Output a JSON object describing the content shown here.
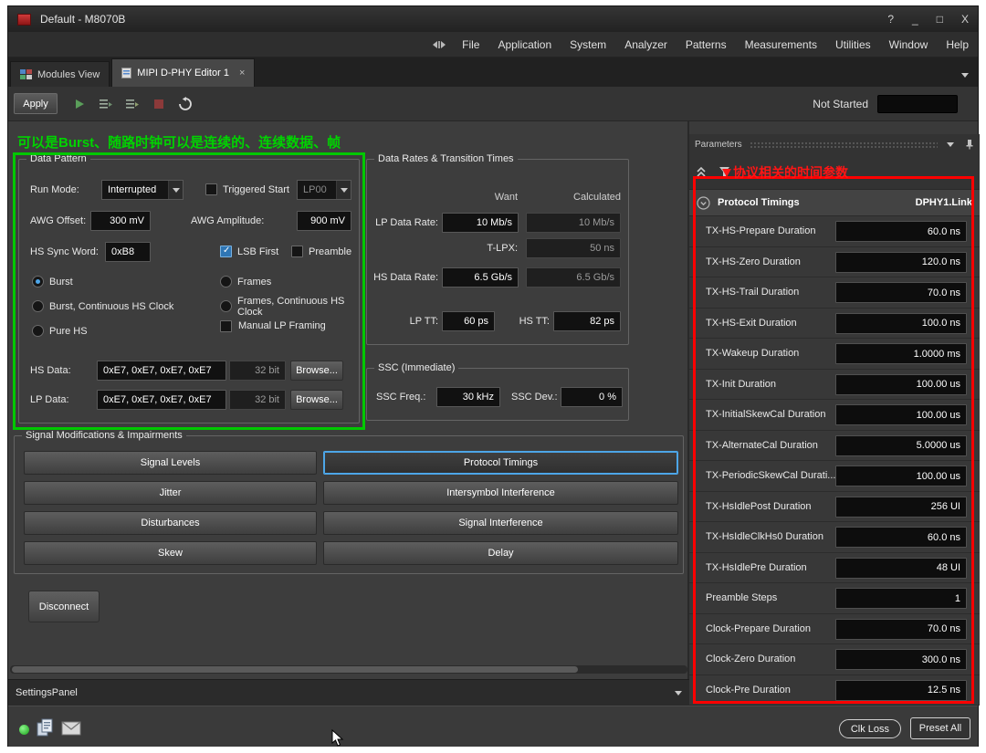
{
  "window": {
    "title": "Default - M8070B",
    "controls": {
      "help": "?",
      "minimize": "_",
      "maximize": "□",
      "close": "X"
    }
  },
  "menu": {
    "items": [
      "File",
      "Application",
      "System",
      "Analyzer",
      "Patterns",
      "Measurements",
      "Utilities",
      "Window",
      "Help"
    ]
  },
  "tabs": {
    "modules": "Modules View",
    "editor": "MIPI D-PHY Editor 1",
    "close": "×"
  },
  "toolbar": {
    "apply": "Apply",
    "status": "Not Started",
    "elapsed": ""
  },
  "annotations": {
    "green": "可以是Burst、随路时钟可以是连续的、连续数据、帧",
    "red": "协议相关的时间参数"
  },
  "colors": {
    "annotation_green": "#00c800",
    "annotation_red": "#ff0000",
    "selection_blue": "#4da6e8"
  },
  "data_pattern": {
    "title": "Data Pattern",
    "run_mode": {
      "label": "Run Mode:",
      "value": "Interrupted"
    },
    "triggered_start": "Triggered Start",
    "lp_state": "LP00",
    "awg_offset": {
      "label": "AWG Offset:",
      "value": "300 mV"
    },
    "awg_amplitude": {
      "label": "AWG Amplitude:",
      "value": "900 mV"
    },
    "hs_sync_word": {
      "label": "HS Sync Word:",
      "value": "0xB8"
    },
    "lsb_first": "LSB First",
    "preamble": "Preamble",
    "modes": [
      {
        "label": "Burst",
        "selected": true
      },
      {
        "label": "Frames",
        "selected": false
      },
      {
        "label": "Burst, Continuous HS Clock",
        "selected": false
      },
      {
        "label": "Frames, Continuous HS Clock",
        "selected": false
      },
      {
        "label": "Pure HS",
        "selected": false
      }
    ],
    "manual_lp_framing": "Manual LP Framing",
    "hs_data": {
      "label": "HS Data:",
      "value": "0xE7, 0xE7, 0xE7, 0xE7",
      "bits": "32 bit",
      "browse": "Browse..."
    },
    "lp_data": {
      "label": "LP Data:",
      "value": "0xE7, 0xE7, 0xE7, 0xE7",
      "bits": "32 bit",
      "browse": "Browse..."
    }
  },
  "data_rates": {
    "title": "Data Rates & Transition Times",
    "col_want": "Want",
    "col_calculated": "Calculated",
    "lp_rate": {
      "label": "LP Data Rate:",
      "want": "10 Mb/s",
      "calculated": "10 Mb/s"
    },
    "t_lpx": {
      "label": "T-LPX:",
      "value": "50 ns"
    },
    "hs_rate": {
      "label": "HS Data Rate:",
      "want": "6.5 Gb/s",
      "calculated": "6.5 Gb/s"
    },
    "lp_tt": {
      "label": "LP TT:",
      "value": "60 ps"
    },
    "hs_tt": {
      "label": "HS TT:",
      "value": "82 ps"
    }
  },
  "ssc": {
    "title": "SSC (Immediate)",
    "freq": {
      "label": "SSC Freq.:",
      "value": "30 kHz"
    },
    "dev": {
      "label": "SSC Dev.:",
      "value": "0 %"
    }
  },
  "impairments": {
    "title": "Signal Modifications & Impairments",
    "buttons": [
      {
        "label": "Signal Levels",
        "active": false
      },
      {
        "label": "Protocol Timings",
        "active": true
      },
      {
        "label": "Jitter",
        "active": false
      },
      {
        "label": "Intersymbol Interference",
        "active": false
      },
      {
        "label": "Disturbances",
        "active": false
      },
      {
        "label": "Signal Interference",
        "active": false
      },
      {
        "label": "Skew",
        "active": false
      },
      {
        "label": "Delay",
        "active": false
      }
    ]
  },
  "disconnect": "Disconnect",
  "parameters": {
    "title": "Parameters",
    "group": {
      "name": "Protocol Timings",
      "scope": "DPHY1.Link"
    },
    "rows": [
      {
        "label": "TX-HS-Prepare Duration",
        "value": "60.0 ns"
      },
      {
        "label": "TX-HS-Zero Duration",
        "value": "120.0 ns"
      },
      {
        "label": "TX-HS-Trail Duration",
        "value": "70.0 ns"
      },
      {
        "label": "TX-HS-Exit Duration",
        "value": "100.0 ns"
      },
      {
        "label": "TX-Wakeup Duration",
        "value": "1.0000 ms"
      },
      {
        "label": "TX-Init Duration",
        "value": "100.00 us"
      },
      {
        "label": "TX-InitialSkewCal Duration",
        "value": "100.00 us"
      },
      {
        "label": "TX-AlternateCal Duration",
        "value": "5.0000 us"
      },
      {
        "label": "TX-PeriodicSkewCal Durati...",
        "value": "100.00 us"
      },
      {
        "label": "TX-HsIdlePost Duration",
        "value": "256 UI"
      },
      {
        "label": "TX-HsIdleClkHs0 Duration",
        "value": "60.0 ns"
      },
      {
        "label": "TX-HsIdlePre Duration",
        "value": "48 UI"
      },
      {
        "label": "Preamble Steps",
        "value": "1"
      },
      {
        "label": "Clock-Prepare Duration",
        "value": "70.0 ns"
      },
      {
        "label": "Clock-Zero Duration",
        "value": "300.0 ns"
      },
      {
        "label": "Clock-Pre Duration",
        "value": "12.5 ns"
      }
    ]
  },
  "settings_panel": {
    "label": "SettingsPanel"
  },
  "status_bar": {
    "clk_loss": "Clk Loss",
    "preset_all": "Preset All"
  }
}
